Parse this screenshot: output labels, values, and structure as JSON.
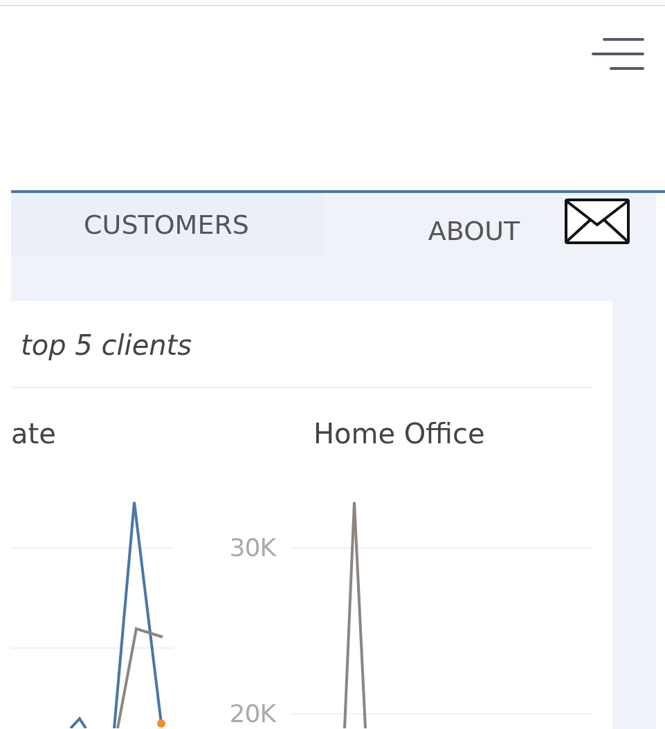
{
  "tabs": [
    {
      "label": "CUSTOMERS",
      "selected": true
    },
    {
      "label": "ABOUT",
      "selected": false
    }
  ],
  "card": {
    "title": "top 5 clients",
    "charts": [
      {
        "title": "ate"
      },
      {
        "title": "Home Office",
        "ticks": [
          "30K",
          "20K"
        ]
      }
    ]
  }
}
